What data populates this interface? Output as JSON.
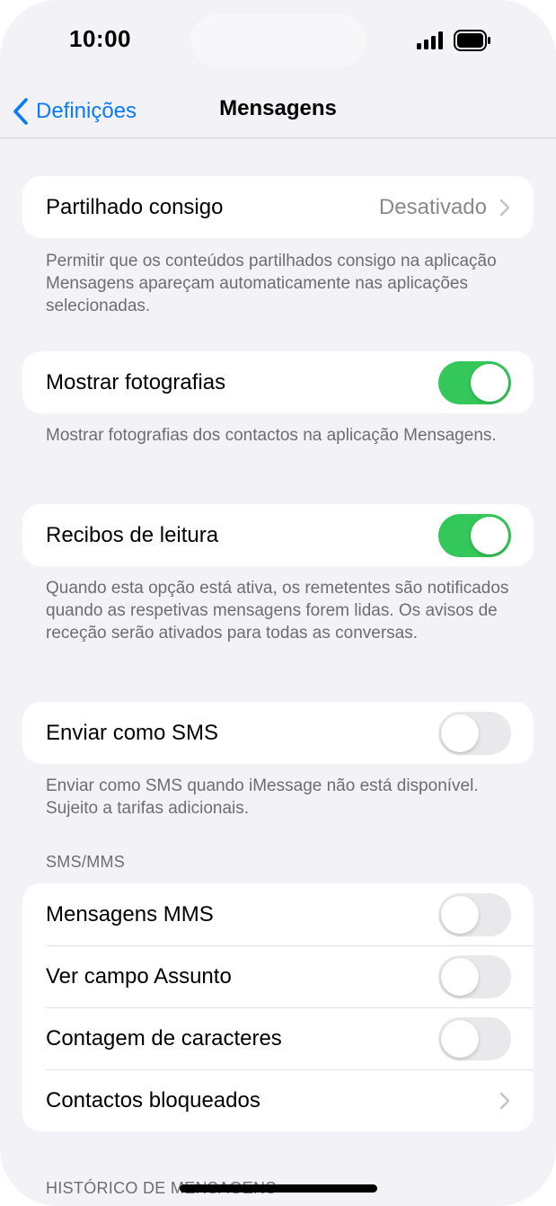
{
  "status": {
    "time": "10:00"
  },
  "nav": {
    "back_label": "Definições",
    "title": "Mensagens"
  },
  "shared_with_you": {
    "label": "Partilhado consigo",
    "value": "Desativado",
    "footer": "Permitir que os conteúdos partilhados consigo na aplicação Mensagens apareçam automaticamente nas aplicações selecionadas."
  },
  "show_photos": {
    "label": "Mostrar fotografias",
    "enabled": true,
    "footer": "Mostrar fotografias dos contactos na aplicação Mensagens."
  },
  "read_receipts": {
    "label": "Recibos de leitura",
    "enabled": true,
    "footer": "Quando esta opção está ativa, os remetentes são notificados quando as respetivas mensagens forem lidas. Os avisos de receção serão ativados para todas as conversas."
  },
  "send_as_sms": {
    "label": "Enviar como SMS",
    "enabled": false,
    "footer": "Enviar como SMS quando iMessage não está disponível. Sujeito a tarifas adicionais."
  },
  "sms_mms": {
    "header": "SMS/MMS",
    "mms_messaging": {
      "label": "Mensagens MMS",
      "enabled": false
    },
    "show_subject": {
      "label": "Ver campo Assunto",
      "enabled": false
    },
    "character_count": {
      "label": "Contagem de caracteres",
      "enabled": false
    },
    "blocked_contacts": {
      "label": "Contactos bloqueados"
    }
  },
  "message_history": {
    "header": "HISTÓRICO DE MENSAGENS"
  },
  "colors": {
    "accent": "#0a7aff",
    "toggle_on": "#34c759",
    "toggle_off": "#e9e9eb",
    "background": "#f2f2f7"
  }
}
